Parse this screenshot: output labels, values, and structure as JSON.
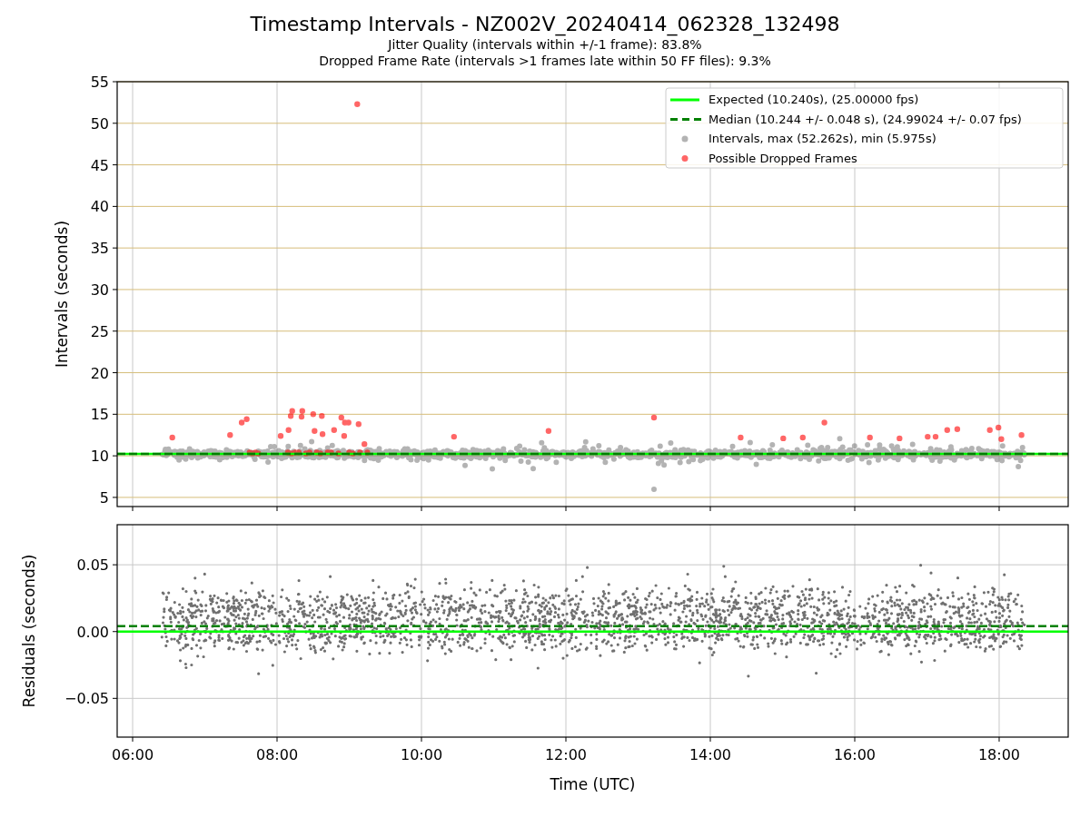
{
  "figure": {
    "title": "Timestamp Intervals - NZ002V_20240414_062328_132498",
    "subtitles": [
      "Jitter Quality (intervals within +/-1 frame): 83.8%",
      "Dropped Frame Rate (intervals >1 frames late within 50 FF files): 9.3%"
    ]
  },
  "intervals_panel": {
    "y_label": "Intervals (seconds)",
    "y_tick_labels": [
      "55",
      "50",
      "45",
      "40",
      "35",
      "30",
      "25",
      "20",
      "15",
      "10",
      "5"
    ],
    "legend": [
      {
        "kind": "line",
        "color": "#00ff00",
        "label": "Expected (10.240s), (25.00000 fps)"
      },
      {
        "kind": "dashed",
        "color": "#008000",
        "label": "Median (10.244 +/- 0.048 s), (24.99024 +/- 0.07 fps)"
      },
      {
        "kind": "dot",
        "color": "#b3b3b3",
        "label": "Intervals, max (52.262s), min (5.975s)"
      },
      {
        "kind": "dot",
        "color": "#ff6666",
        "label": "Possible Dropped Frames"
      }
    ]
  },
  "residuals_panel": {
    "y_label": "Residuals (seconds)",
    "y_tick_labels": [
      "0.05",
      "0.00",
      "−0.05"
    ],
    "x_tick_labels": [
      "06:00",
      "08:00",
      "10:00",
      "12:00",
      "14:00",
      "16:00",
      "18:00"
    ],
    "x_label": "Time (UTC)"
  }
}
